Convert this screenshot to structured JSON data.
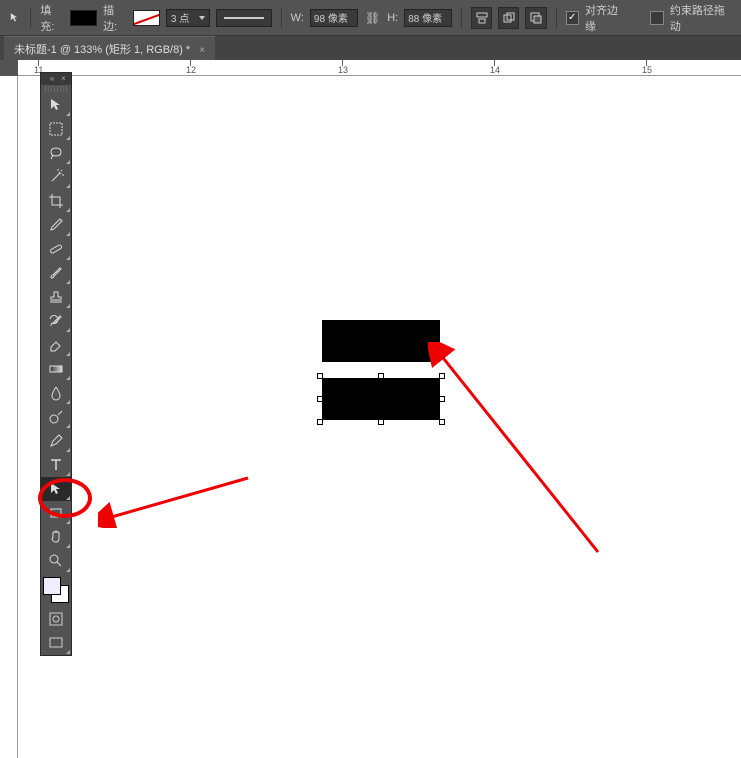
{
  "toolbar": {
    "fill_label": "填充:",
    "stroke_label": "描边:",
    "stroke_width": "3 点",
    "w_label": "W:",
    "w_value": "98 像素",
    "h_label": "H:",
    "h_value": "88 像素",
    "align_edges_label": "对齐边缘",
    "constrain_path_label": "约束路径拖动"
  },
  "tab": {
    "title": "未标题-1 @ 133% (矩形 1, RGB/8) *"
  },
  "ruler": {
    "marks": [
      "11",
      "12",
      "13",
      "14",
      "15"
    ]
  },
  "tools": {
    "items": [
      {
        "name": "move-tool",
        "icon": "move"
      },
      {
        "name": "marquee-tool",
        "icon": "marquee"
      },
      {
        "name": "lasso-tool",
        "icon": "lasso"
      },
      {
        "name": "magic-wand-tool",
        "icon": "wand"
      },
      {
        "name": "crop-tool",
        "icon": "crop"
      },
      {
        "name": "eyedropper-tool",
        "icon": "eyedropper"
      },
      {
        "name": "healing-brush-tool",
        "icon": "bandaid"
      },
      {
        "name": "brush-tool",
        "icon": "brush"
      },
      {
        "name": "clone-stamp-tool",
        "icon": "stamp"
      },
      {
        "name": "history-brush-tool",
        "icon": "history"
      },
      {
        "name": "eraser-tool",
        "icon": "eraser"
      },
      {
        "name": "gradient-tool",
        "icon": "gradient"
      },
      {
        "name": "blur-tool",
        "icon": "blur"
      },
      {
        "name": "dodge-tool",
        "icon": "dodge"
      },
      {
        "name": "pen-tool",
        "icon": "pen"
      },
      {
        "name": "type-tool",
        "icon": "type"
      },
      {
        "name": "path-selection-tool",
        "icon": "pathsel",
        "active": true
      },
      {
        "name": "rectangle-tool",
        "icon": "rect"
      },
      {
        "name": "hand-tool",
        "icon": "hand"
      },
      {
        "name": "zoom-tool",
        "icon": "zoom"
      }
    ]
  }
}
